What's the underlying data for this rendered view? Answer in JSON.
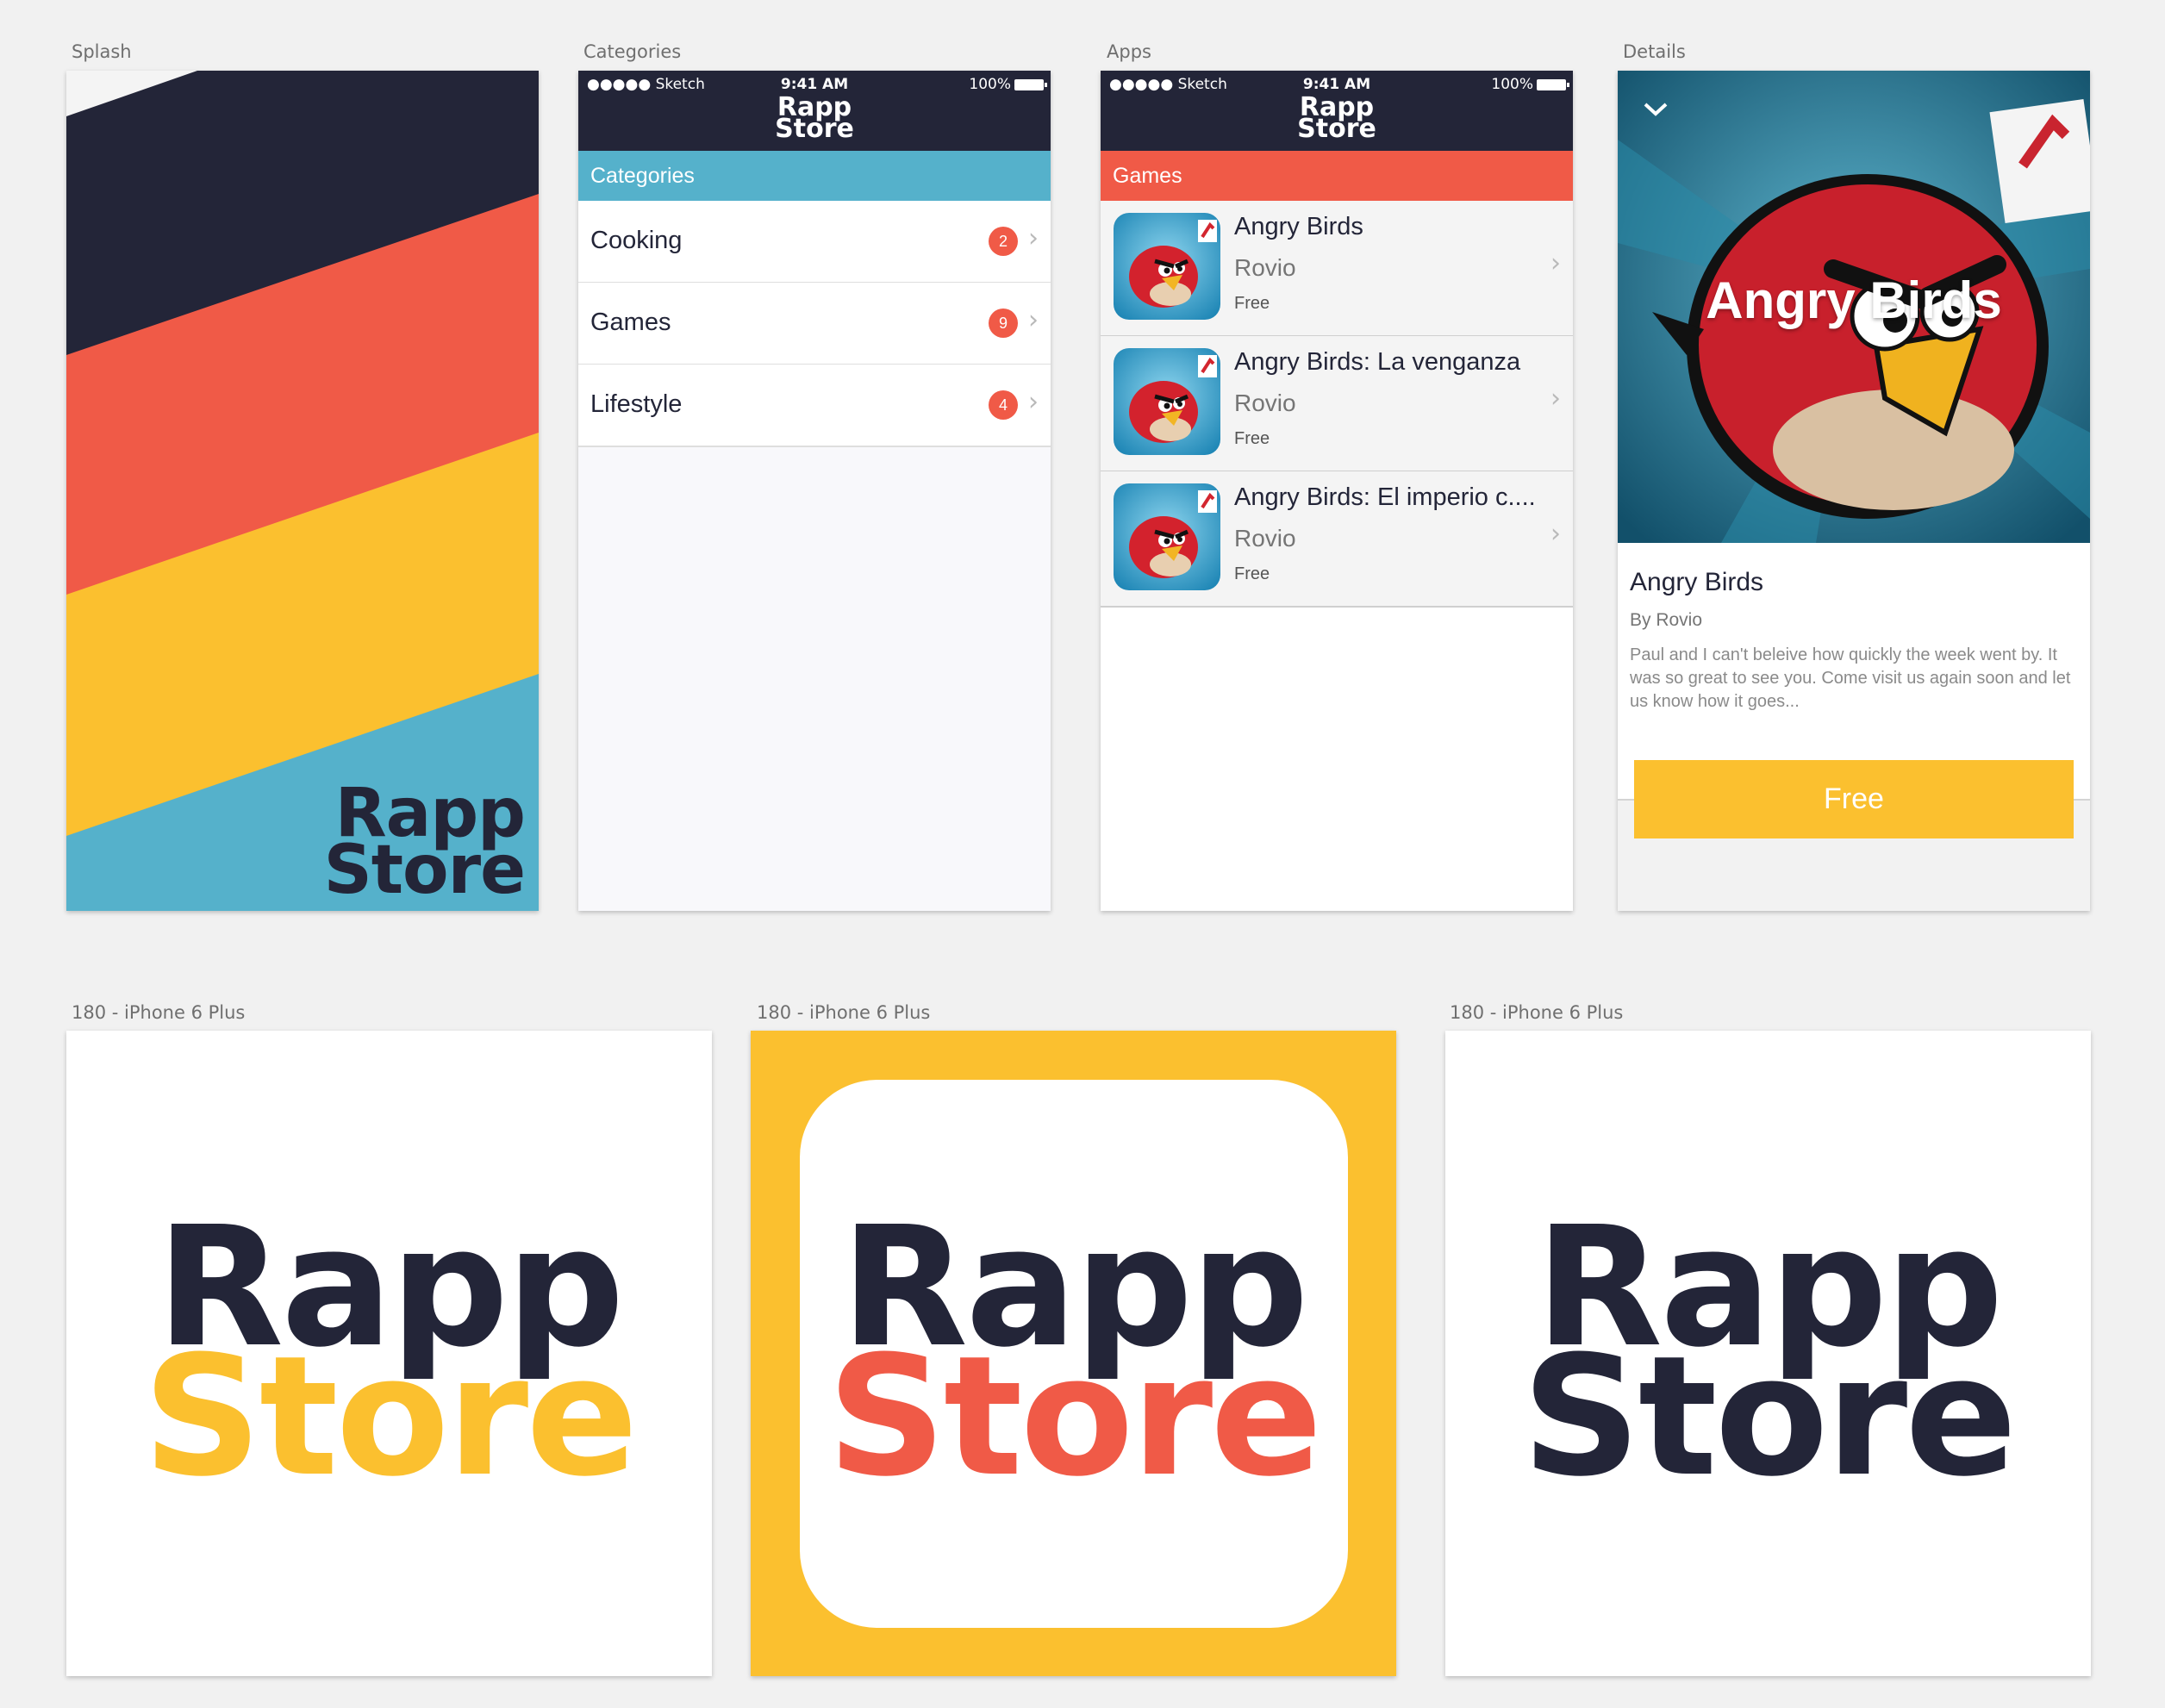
{
  "labels": {
    "splash": "Splash",
    "categories": "Categories",
    "apps": "Apps",
    "details": "Details",
    "icon1": "180 - iPhone 6 Plus",
    "icon2": "180 - iPhone 6 Plus",
    "icon3": "180 - iPhone 6 Plus"
  },
  "brand": {
    "line1": "Rapp",
    "line2": "Store",
    "colors": {
      "navy": "#232538",
      "red": "#f05a47",
      "yellow": "#fbc02f",
      "blue": "#55b1cb"
    }
  },
  "status_bar": {
    "carrier": "●●●●● Sketch",
    "time": "9:41 AM",
    "battery": "100%"
  },
  "categories_screen": {
    "header": "Categories",
    "items": [
      {
        "label": "Cooking",
        "count": "2"
      },
      {
        "label": "Games",
        "count": "9"
      },
      {
        "label": "Lifestyle",
        "count": "4"
      }
    ]
  },
  "apps_screen": {
    "header": "Games",
    "items": [
      {
        "name": "Angry Birds",
        "developer": "Rovio",
        "price": "Free"
      },
      {
        "name": "Angry Birds: La venganza",
        "developer": "Rovio",
        "price": "Free"
      },
      {
        "name": "Angry Birds: El imperio c....",
        "developer": "Rovio",
        "price": "Free"
      }
    ]
  },
  "details_screen": {
    "hero_title": "Angry Birds",
    "title": "Angry Birds",
    "by": "By Rovio",
    "description": "Paul and I can't beleive how quickly the week went by. It was so great to see you. Come visit us again soon and let us know how it goes...",
    "button": "Free"
  }
}
